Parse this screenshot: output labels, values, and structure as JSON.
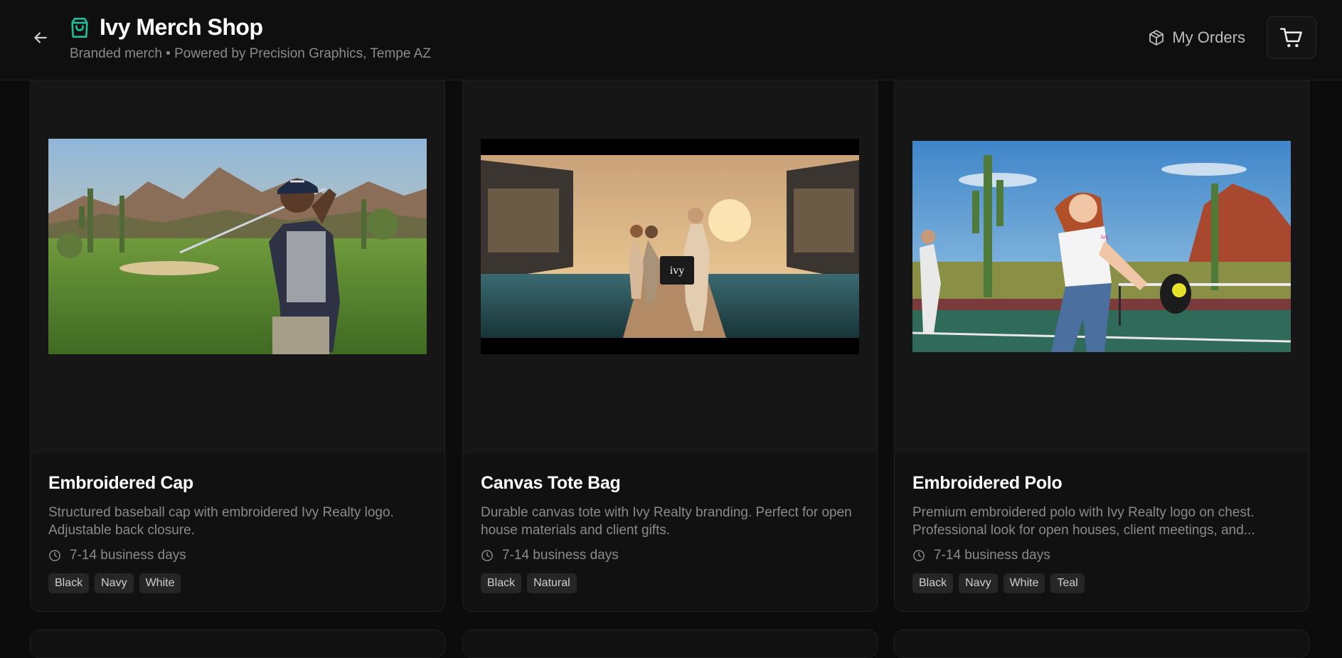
{
  "header": {
    "title": "Ivy Merch Shop",
    "subtitle": "Branded merch • Powered by Precision Graphics, Tempe AZ",
    "orders_label": "My Orders"
  },
  "colors": {
    "accent": "#19c39b",
    "background": "#0c0c0c",
    "card": "#111111"
  },
  "icons": {
    "back": "arrow-left-icon",
    "brand": "shopping-bag-icon",
    "orders": "package-icon",
    "cart": "shopping-cart-icon",
    "eta": "clock-icon"
  },
  "products": [
    {
      "title": "Embroidered Cap",
      "description": "Structured baseball cap with embroidered Ivy Realty logo. Adjustable back closure.",
      "eta": "7-14 business days",
      "colors": [
        "Black",
        "Navy",
        "White"
      ],
      "image_text": "IVY"
    },
    {
      "title": "Canvas Tote Bag",
      "description": "Durable canvas tote with Ivy Realty branding. Perfect for open house materials and client gifts.",
      "eta": "7-14 business days",
      "colors": [
        "Black",
        "Natural"
      ],
      "image_text": "ivy"
    },
    {
      "title": "Embroidered Polo",
      "description": "Premium embroidered polo with Ivy Realty logo on chest. Professional look for open houses, client meetings, and...",
      "eta": "7-14 business days",
      "colors": [
        "Black",
        "Navy",
        "White",
        "Teal"
      ],
      "image_text": "ivy"
    }
  ]
}
